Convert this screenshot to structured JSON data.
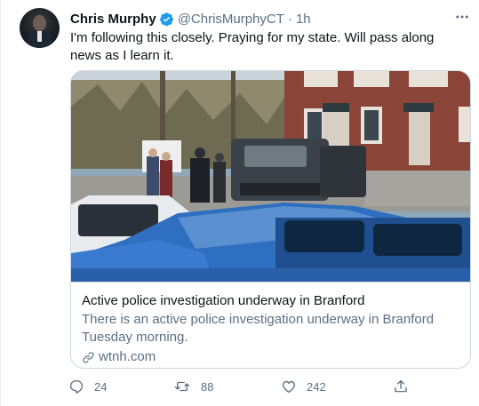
{
  "tweet": {
    "author_name": "Chris Murphy",
    "handle": "@ChrisMurphyCT",
    "separator": "·",
    "time": "1h",
    "text": "I'm following this closely. Praying for my state. Will pass along news as I learn it.",
    "verified": true
  },
  "card": {
    "title": "Active police investigation underway in Branford",
    "description": "There is an active police investigation underway in Branford Tuesday morning.",
    "domain": "wtnh.com",
    "image_icon": "news-photo-police-scene"
  },
  "actions": {
    "reply_count": "24",
    "retweet_count": "88",
    "like_count": "242"
  },
  "colors": {
    "secondary_text": "#5b7083",
    "verified_blue": "#1d9bf0",
    "border": "#cfd9de"
  }
}
